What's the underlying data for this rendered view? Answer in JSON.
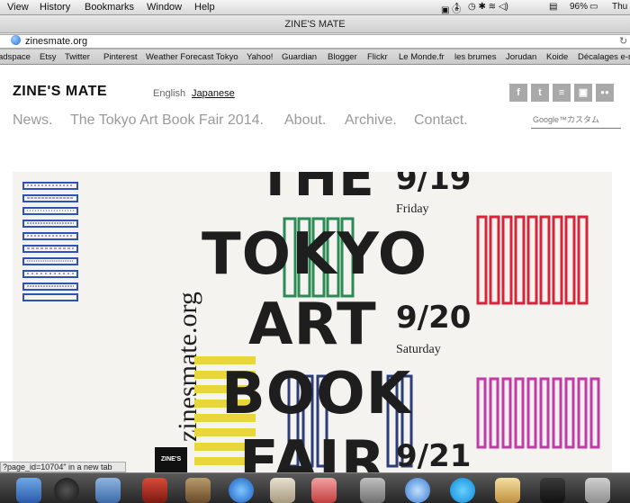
{
  "menubar": {
    "items": [
      "View",
      "History",
      "Bookmarks",
      "Window",
      "Help"
    ],
    "status": {
      "day": "Thu",
      "battery": "96%",
      "input_source": "1"
    }
  },
  "window": {
    "title": "ZINE'S MATE"
  },
  "address": {
    "url": "zinesmate.org"
  },
  "bookmarks": [
    "adspace",
    "Etsy",
    "Twitter",
    "Pinterest",
    "Weather Forecast Tokyo",
    "Yahoo!",
    "Guardian",
    "Blogger",
    "Flickr",
    "Le Monde.fr",
    "les brumes",
    "Jorudan",
    "Koide",
    "Décalages e-n"
  ],
  "site": {
    "logo": "ZINE'S MATE",
    "lang_en": "English",
    "lang_ja": "Japanese",
    "social": [
      {
        "icon": "facebook-icon",
        "glyph": "f"
      },
      {
        "icon": "twitter-icon",
        "glyph": "t"
      },
      {
        "icon": "rss-icon",
        "glyph": "≡"
      },
      {
        "icon": "instagram-icon",
        "glyph": "▣"
      },
      {
        "icon": "flickr-icon",
        "glyph": "●●"
      }
    ],
    "nav": [
      "News.",
      "The Tokyo Art Book Fair 2014.",
      "About.",
      "Archive.",
      "Contact."
    ],
    "search_placeholder": "Google™カスタム"
  },
  "poster": {
    "vertical_text": "zinesmate.org",
    "lines": [
      "THE",
      "TOKYO",
      "ART",
      "BOOK",
      "FAIR"
    ],
    "dates": [
      {
        "date": "9/19",
        "day": "Friday"
      },
      {
        "date": "9/20",
        "day": "Saturday"
      },
      {
        "date": "9/21",
        "day": ""
      }
    ],
    "small_logo": "ZINE'S",
    "colors": {
      "blue": "#2f52b8",
      "red": "#d8243a",
      "green": "#2b8a55",
      "yellow": "#e8d63a",
      "magenta": "#c33aa7",
      "navy": "#2a3d7a"
    }
  },
  "status_text": "?page_id=10704\" in a new tab"
}
